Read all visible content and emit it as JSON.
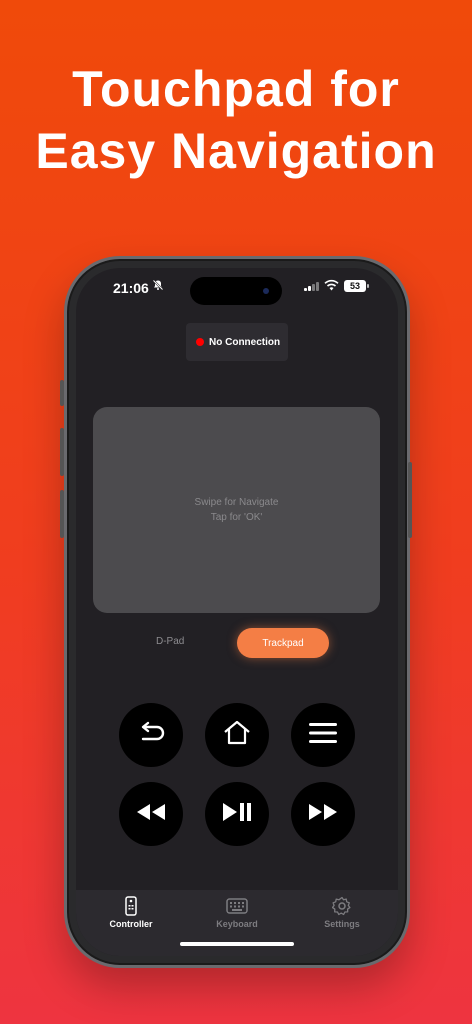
{
  "promo": {
    "headline_line1": "Touchpad for",
    "headline_line2": "Easy Navigation"
  },
  "status_bar": {
    "time": "21:06",
    "battery": "53",
    "icons": [
      "bell-slash-icon",
      "signal-icon",
      "wifi-icon",
      "battery-icon"
    ]
  },
  "connection": {
    "label": "No Connection",
    "status_color": "#ff0000"
  },
  "trackpad": {
    "hint_line1": "Swipe for Navigate",
    "hint_line2": "Tap for 'OK'"
  },
  "mode_toggle": {
    "options": [
      "D-Pad",
      "Trackpad"
    ],
    "selected": "Trackpad"
  },
  "remote_buttons": [
    {
      "icon": "back-icon"
    },
    {
      "icon": "home-icon"
    },
    {
      "icon": "menu-icon"
    },
    {
      "icon": "rewind-icon"
    },
    {
      "icon": "play-pause-icon"
    },
    {
      "icon": "fast-forward-icon"
    }
  ],
  "tabs": [
    {
      "label": "Controller",
      "icon": "remote-icon",
      "active": true
    },
    {
      "label": "Keyboard",
      "icon": "keyboard-icon",
      "active": false
    },
    {
      "label": "Settings",
      "icon": "gear-icon",
      "active": false
    }
  ],
  "colors": {
    "accent": "#f47e45",
    "background_top": "#f04a0a",
    "background_bottom": "#ee3440",
    "screen_bg": "#222024",
    "tab_active": "#ffffff",
    "tab_inactive": "#7d7c80"
  }
}
